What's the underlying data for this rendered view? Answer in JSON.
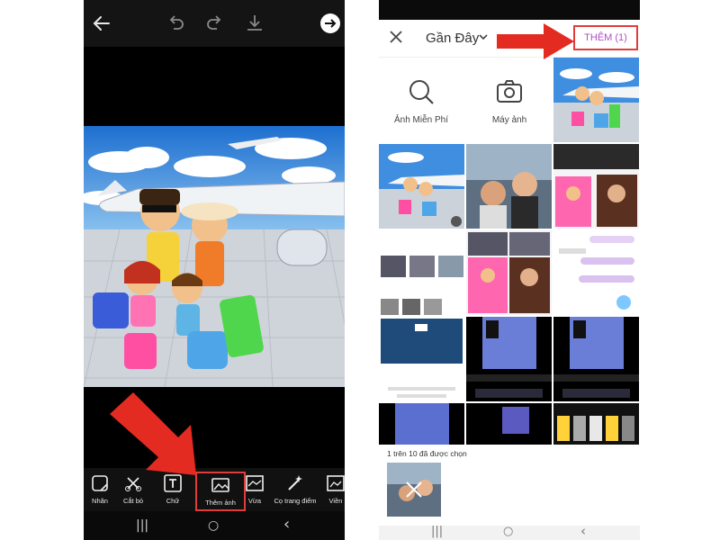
{
  "left_phone": {
    "topbar": {
      "icons": [
        "back-arrow-icon",
        "undo-icon",
        "redo-icon",
        "download-icon",
        "next-arrow-icon"
      ]
    },
    "tools": [
      {
        "label": "Nhãn",
        "icon": "sticker-icon"
      },
      {
        "label": "Cắt bỏ",
        "icon": "cutout-icon"
      },
      {
        "label": "Chữ",
        "icon": "text-icon"
      },
      {
        "label": "Thêm ảnh",
        "icon": "add-photo-icon",
        "selected": true
      },
      {
        "label": "Vừa",
        "icon": "fit-icon"
      },
      {
        "label": "Cọ trang điểm",
        "icon": "magic-brush-icon"
      },
      {
        "label": "Viền",
        "icon": "border-icon"
      }
    ],
    "nav": {
      "recent": "|||",
      "home": "○",
      "back": "‹"
    }
  },
  "right_phone": {
    "header": {
      "title": "Gần Đây",
      "add_button": "THÊM (1)"
    },
    "sources": [
      {
        "label": "Ảnh Miễn Phí",
        "icon": "search-icon"
      },
      {
        "label": "Máy ảnh",
        "icon": "camera-icon"
      }
    ],
    "selection": {
      "label": "1 trên 10 đã được chọn"
    },
    "nav": {
      "recent": "|||",
      "home": "○",
      "back": "‹"
    }
  },
  "colors": {
    "highlight_red": "#e23b3b",
    "add_text_purple": "#b04ec0",
    "sky_blue": "#2a7fd4"
  }
}
